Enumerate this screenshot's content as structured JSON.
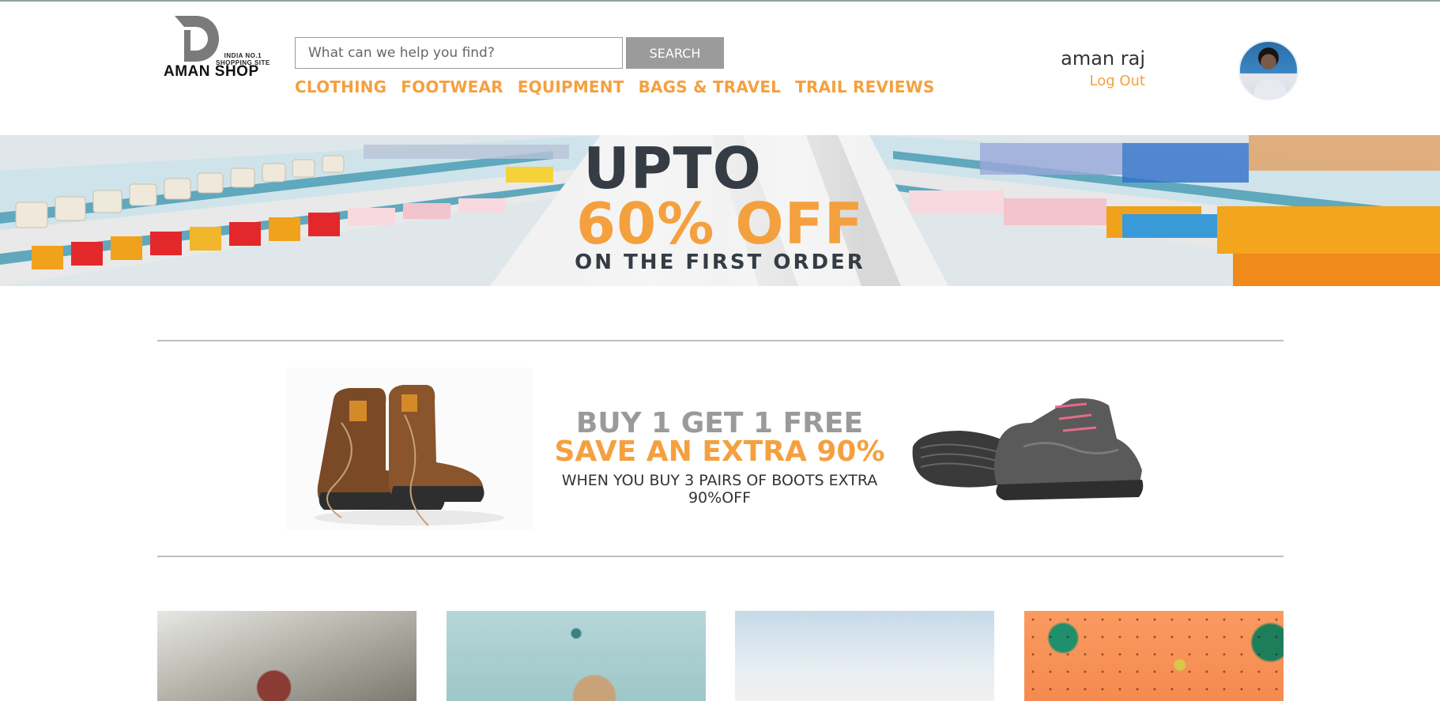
{
  "logo": {
    "tagline": "INDIA NO.1\nSHOPPING SITE",
    "brand": "AMAN SHOP",
    "letter": "D"
  },
  "search": {
    "placeholder": "What can we help you find?",
    "button_label": "SEARCH"
  },
  "nav": {
    "items": [
      "CLOTHING",
      "FOOTWEAR",
      "EQUIPMENT",
      "BAGS & TRAVEL",
      "TRAIL REVIEWS"
    ]
  },
  "user": {
    "name": "aman raj",
    "logout_label": "Log Out"
  },
  "hero": {
    "line1": "UPTO",
    "line2": "60% OFF",
    "line3": "ON THE FIRST ORDER"
  },
  "promo": {
    "line1": "BUY 1 GET 1 FREE",
    "line2": "SAVE AN EXTRA 90%",
    "line3": "WHEN YOU BUY 3 PAIRS OF BOOTS EXTRA 90%OFF"
  },
  "colors": {
    "accent": "#f5a03f",
    "dark_text": "#353c44",
    "grey_button": "#9b9b9b"
  }
}
